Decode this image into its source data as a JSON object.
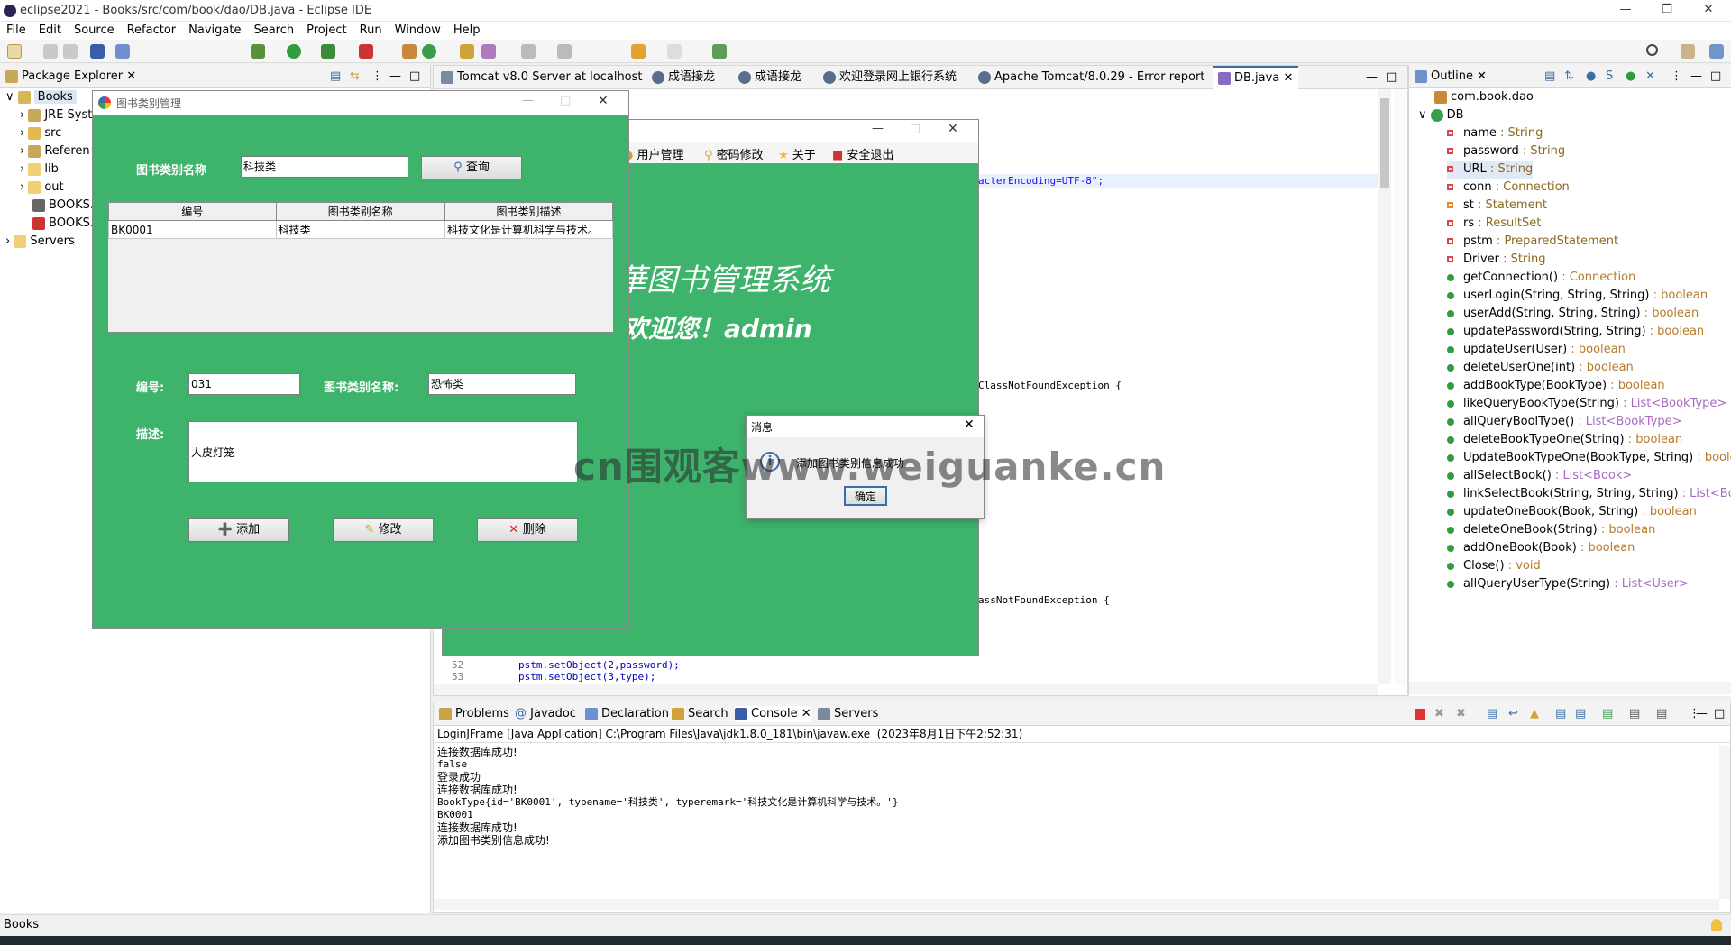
{
  "window": {
    "title": "eclipse2021 - Books/src/com/book/dao/DB.java - Eclipse IDE"
  },
  "menu": [
    "File",
    "Edit",
    "Source",
    "Refactor",
    "Navigate",
    "Search",
    "Project",
    "Run",
    "Window",
    "Help"
  ],
  "package_explorer": {
    "tab_label": "Package Explorer",
    "items": [
      "Books",
      "JRE Syst",
      "src",
      "Referen",
      "lib",
      "out",
      "BOOKS.",
      "BOOKS.",
      "Servers"
    ]
  },
  "editor_tabs": [
    "Tomcat v8.0 Server at localhost",
    "成语接龙",
    "成语接龙",
    "欢迎登录网上银行系统",
    "Apache Tomcat/8.0.29 - Error report",
    "DB.java"
  ],
  "editor": {
    "frag_encoding": "acterEncoding=UTF-8\";",
    "frag_exception1": "ClassNotFoundException {",
    "frag_exception2": "assNotFoundException {",
    "line_52_num": "52",
    "line_52_code": "pstm.setObject(2,password);",
    "line_53_num": "53",
    "line_53_code": "pstm.setObject(3,type);"
  },
  "outline": {
    "tab_label": "Outline",
    "package": "com.book.dao",
    "class": "DB",
    "members": [
      {
        "name": "name",
        "type": " : String",
        "kind": "field"
      },
      {
        "name": "password",
        "type": " : String",
        "kind": "field"
      },
      {
        "name": "URL",
        "type": " : String",
        "kind": "field"
      },
      {
        "name": "conn",
        "type": " : Connection",
        "kind": "field"
      },
      {
        "name": "st",
        "type": " : Statement",
        "kind": "field-static"
      },
      {
        "name": "rs",
        "type": " : ResultSet",
        "kind": "field"
      },
      {
        "name": "pstm",
        "type": " : PreparedStatement",
        "kind": "field"
      },
      {
        "name": "Driver",
        "type": " : String",
        "kind": "field"
      },
      {
        "name": "getConnection()",
        "type": " : Connection",
        "kind": "method"
      },
      {
        "name": "userLogin(String, String, String)",
        "type": " : boolean",
        "kind": "method"
      },
      {
        "name": "userAdd(String, String, String)",
        "type": " : boolean",
        "kind": "method"
      },
      {
        "name": "updatePassword(String, String)",
        "type": " : boolean",
        "kind": "method"
      },
      {
        "name": "updateUser(User)",
        "type": " : boolean",
        "kind": "method"
      },
      {
        "name": "deleteUserOne(int)",
        "type": " : boolean",
        "kind": "method"
      },
      {
        "name": "addBookType(BookType)",
        "type": " : boolean",
        "kind": "method"
      },
      {
        "name": "likeQueryBookType(String)",
        "type": " : List<BookType>",
        "kind": "method"
      },
      {
        "name": "allQueryBoolType()",
        "type": " : List<BookType>",
        "kind": "method"
      },
      {
        "name": "deleteBookTypeOne(String)",
        "type": " : boolean",
        "kind": "method"
      },
      {
        "name": "UpdateBookTypeOne(BookType, String)",
        "type": " : boolean",
        "kind": "method"
      },
      {
        "name": "allSelectBook()",
        "type": " : List<Book>",
        "kind": "method"
      },
      {
        "name": "linkSelectBook(String, String, String)",
        "type": " : List<Book>",
        "kind": "method"
      },
      {
        "name": "updateOneBook(Book, String)",
        "type": " : boolean",
        "kind": "method"
      },
      {
        "name": "deleteOneBook(String)",
        "type": " : boolean",
        "kind": "method"
      },
      {
        "name": "addOneBook(Book)",
        "type": " : boolean",
        "kind": "method"
      },
      {
        "name": "Close()",
        "type": " : void",
        "kind": "method"
      },
      {
        "name": "allQueryUserType(String)",
        "type": " : List<User>",
        "kind": "method"
      }
    ]
  },
  "bottom_tabs": [
    "Problems",
    "Javadoc",
    "Declaration",
    "Search",
    "Console",
    "Servers"
  ],
  "console": {
    "header": "LoginJFrame [Java Application] C:\\Program Files\\Java\\jdk1.8.0_181\\bin\\javaw.exe  (2023年8月1日下午2:52:31)",
    "lines": [
      "连接数据库成功!",
      "false",
      "登录成功",
      "连接数据库成功!",
      "BookType{id='BK0001', typename='科技类', typeremark='科技文化是计算机科学与技术。'}",
      "BK0001",
      "连接数据库成功!",
      "添加图书类别信息成功!"
    ]
  },
  "status_bar": {
    "text": "Books"
  },
  "main_frame": {
    "menu": [
      "用户管理",
      "密码修改",
      "关于",
      "安全退出"
    ],
    "heading": "華图书管理系统",
    "welcome": "欢迎您！admin"
  },
  "category_dialog": {
    "title": "图书类别管理",
    "search_label": "图书类别名称",
    "search_value": "科技类",
    "query_button": "查询",
    "table": {
      "headers": [
        "编号",
        "图书类别名称",
        "图书类别描述"
      ],
      "rows": [
        [
          "BK0001",
          "科技类",
          "科技文化是计算机科学与技术。"
        ]
      ]
    },
    "id_label": "编号:",
    "id_value": "031",
    "name_label": "图书类别名称:",
    "name_value": "恐怖类",
    "desc_label": "描述:",
    "desc_value": "人皮灯笼",
    "add_button": "添加",
    "edit_button": "修改",
    "delete_button": "删除"
  },
  "message_dialog": {
    "title": "消息",
    "message": "添加图书类别信息成功",
    "ok_button": "确定"
  },
  "watermark": "cn围观客www.weiguanke.cn"
}
